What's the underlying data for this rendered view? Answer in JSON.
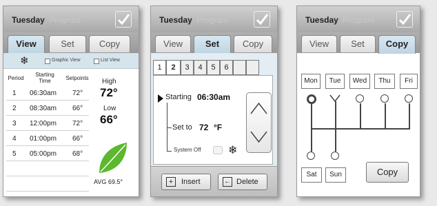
{
  "panel_view": {
    "title": "Tuesday",
    "title_dim": "Program",
    "tabs": [
      "View",
      "Set",
      "Copy"
    ],
    "view_modes": [
      "Graphic View",
      "List View"
    ],
    "columns": [
      "Period",
      "Starting\nTime",
      "Setpoints"
    ],
    "rows": [
      {
        "period": "1",
        "time": "06:30am",
        "setpoint": "72°"
      },
      {
        "period": "2",
        "time": "08:30am",
        "setpoint": "66°"
      },
      {
        "period": "3",
        "time": "12:00pm",
        "setpoint": "72°"
      },
      {
        "period": "4",
        "time": "01:00pm",
        "setpoint": "66°"
      },
      {
        "period": "5",
        "time": "05:00pm",
        "setpoint": "68°"
      }
    ],
    "high_label": "High",
    "high_value": "72°",
    "low_label": "Low",
    "low_value": "66°",
    "avg_label": "AVG 69.5°"
  },
  "panel_set": {
    "title": "Tuesday",
    "title_dim": "Program",
    "tabs": [
      "View",
      "Set",
      "Copy"
    ],
    "period_tabs": [
      "1",
      "2",
      "3",
      "4",
      "5",
      "6",
      "",
      ""
    ],
    "starting_label": "Starting",
    "starting_value": "06:30am",
    "set_to_label": "Set to",
    "set_to_value": "72",
    "unit": "°F",
    "system_off_label": "System Off",
    "insert_label": "Insert",
    "delete_label": "Delete"
  },
  "panel_copy": {
    "title": "Tuesday",
    "title_dim": "Program",
    "tabs": [
      "View",
      "Set",
      "Copy"
    ],
    "weekdays": [
      "Mon",
      "Tue",
      "Wed",
      "Thu",
      "Fri"
    ],
    "weekend": [
      "Sat",
      "Sun"
    ],
    "copy_button": "Copy"
  },
  "colors": {
    "accent": "#c7dbe8",
    "leaf": "#5cb82f"
  }
}
